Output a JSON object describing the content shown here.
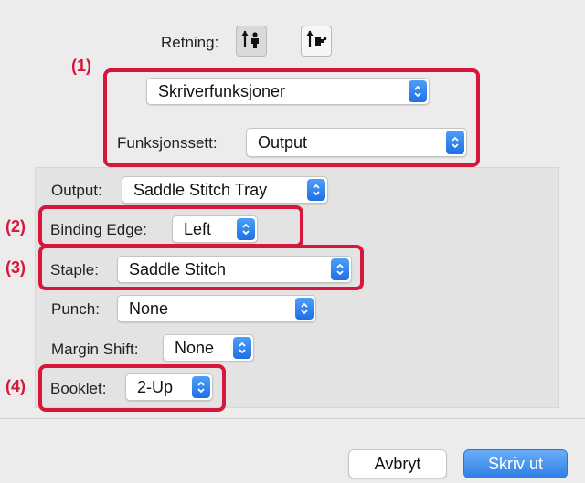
{
  "orientation": {
    "label": "Retning:",
    "options": [
      {
        "icon": "portrait-orientation-icon",
        "selected": true
      },
      {
        "icon": "landscape-orientation-icon",
        "selected": false
      }
    ]
  },
  "top_popup": {
    "value": "Skriverfunksjoner"
  },
  "feature_set": {
    "label": "Funksjonssett:",
    "value": "Output"
  },
  "settings": {
    "output": {
      "label": "Output:",
      "value": "Saddle Stitch Tray"
    },
    "binding_edge": {
      "label": "Binding Edge:",
      "value": "Left"
    },
    "staple": {
      "label": "Staple:",
      "value": "Saddle Stitch"
    },
    "punch": {
      "label": "Punch:",
      "value": "None"
    },
    "margin_shift": {
      "label": "Margin Shift:",
      "value": "None"
    },
    "booklet": {
      "label": "Booklet:",
      "value": "2-Up"
    }
  },
  "callouts": {
    "c1": "(1)",
    "c2": "(2)",
    "c3": "(3)",
    "c4": "(4)"
  },
  "buttons": {
    "cancel": "Avbryt",
    "print": "Skriv ut"
  },
  "colors": {
    "accent": "#2f7fe6",
    "callout": "#d6173b"
  }
}
